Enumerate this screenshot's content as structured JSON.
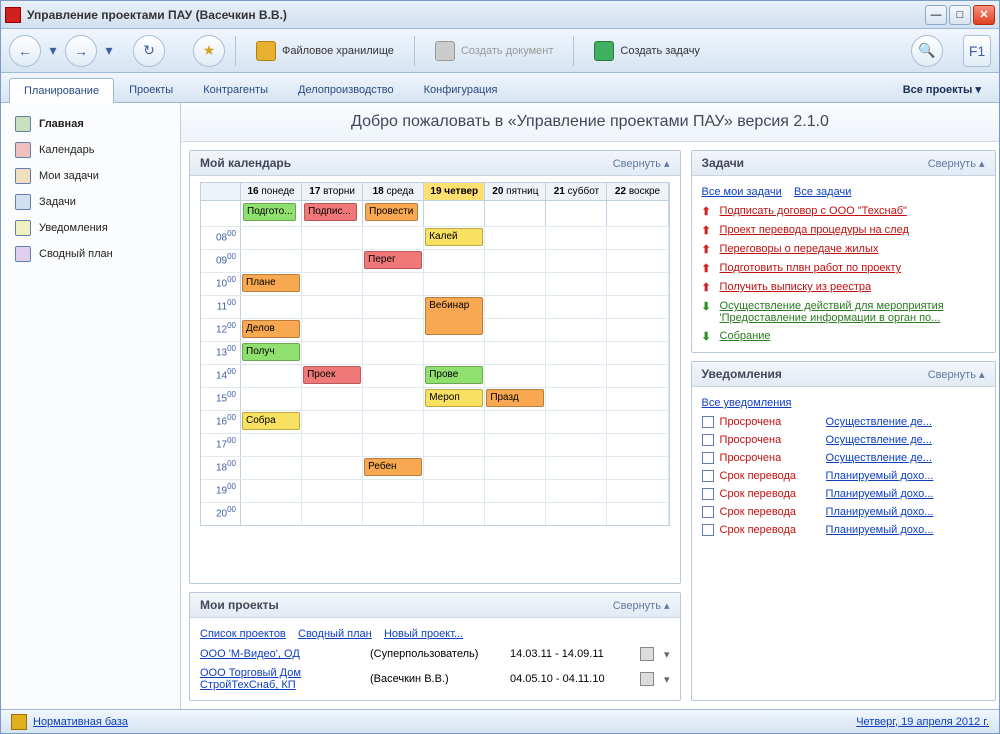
{
  "window": {
    "title": "Управление проектами ПАУ (Васечкин В.В.)"
  },
  "toolbar": {
    "file_storage": "Файловое хранилище",
    "create_doc": "Создать документ",
    "create_task": "Создать задачу"
  },
  "tabs": {
    "items": [
      "Планирование",
      "Проекты",
      "Контрагенты",
      "Делопроизводство",
      "Конфигурация"
    ],
    "right": "Все проекты ▾"
  },
  "sidebar": {
    "items": [
      {
        "label": "Главная"
      },
      {
        "label": "Календарь"
      },
      {
        "label": "Мои задачи"
      },
      {
        "label": "Задачи"
      },
      {
        "label": "Уведомления"
      },
      {
        "label": "Сводный план"
      }
    ]
  },
  "welcome": "Добро пожаловать в «Управление проектами ПАУ» версия 2.1.0",
  "collapse_label": "Свернуть ▴",
  "calendar": {
    "title": "Мой календарь",
    "days": [
      {
        "d": "16",
        "w": "понеде"
      },
      {
        "d": "17",
        "w": "вторни"
      },
      {
        "d": "18",
        "w": "среда"
      },
      {
        "d": "19",
        "w": "четвер"
      },
      {
        "d": "20",
        "w": "пятниц"
      },
      {
        "d": "21",
        "w": "суббот"
      },
      {
        "d": "22",
        "w": "воскре"
      }
    ],
    "hours": [
      "08",
      "09",
      "10",
      "11",
      "12",
      "13",
      "14",
      "15",
      "16",
      "17",
      "18",
      "19",
      "20"
    ],
    "allday": [
      {
        "day": 0,
        "label": "Подгото...",
        "color": "green"
      },
      {
        "day": 1,
        "label": "Подпис...",
        "color": "red"
      },
      {
        "day": 2,
        "label": "Провести",
        "color": "orange"
      }
    ],
    "events": [
      {
        "day": 3,
        "hour": "08",
        "label": "Калей",
        "color": "yellow"
      },
      {
        "day": 2,
        "hour": "09",
        "label": "Перег",
        "color": "red"
      },
      {
        "day": 0,
        "hour": "10",
        "label": "Плане",
        "color": "orange"
      },
      {
        "day": 3,
        "hour": "11",
        "label": "Вебинар",
        "color": "orange",
        "tall": true
      },
      {
        "day": 0,
        "hour": "12",
        "label": "Делов",
        "color": "orange"
      },
      {
        "day": 0,
        "hour": "13",
        "label": "Получ",
        "color": "green"
      },
      {
        "day": 1,
        "hour": "14",
        "label": "Проек",
        "color": "red"
      },
      {
        "day": 3,
        "hour": "14",
        "label": "Прове",
        "color": "green"
      },
      {
        "day": 3,
        "hour": "15",
        "label": "Мероп",
        "color": "yellow"
      },
      {
        "day": 4,
        "hour": "15",
        "label": "Празд",
        "color": "orange"
      },
      {
        "day": 0,
        "hour": "16",
        "label": "Собра",
        "color": "yellow"
      },
      {
        "day": 2,
        "hour": "18",
        "label": "Ребен",
        "color": "orange"
      }
    ]
  },
  "tasks": {
    "title": "Задачи",
    "links": {
      "mine": "Все мои задачи",
      "all": "Все задачи"
    },
    "items": [
      {
        "dir": "up",
        "label": "Подписать договор с ООО \"Техснаб\""
      },
      {
        "dir": "up",
        "label": "Проект перевода процедуры на след"
      },
      {
        "dir": "up",
        "label": "Переговоры о передаче жилых"
      },
      {
        "dir": "up",
        "label": "Подготовить плвн работ по проекту"
      },
      {
        "dir": "up",
        "label": "Получить выписку из реестра"
      },
      {
        "dir": "down",
        "label": "Осуществление действий для мероприятия 'Предоставление информации в орган по..."
      },
      {
        "dir": "down",
        "label": "Собрание"
      }
    ]
  },
  "notifications": {
    "title": "Уведомления",
    "link": "Все уведомления",
    "items": [
      {
        "status": "Просрочена",
        "link": "Осуществление де..."
      },
      {
        "status": "Просрочена",
        "link": "Осуществление де..."
      },
      {
        "status": "Просрочена",
        "link": "Осуществление де..."
      },
      {
        "status": "Срок перевода",
        "link": "Планируемый дохо..."
      },
      {
        "status": "Срок перевода",
        "link": "Планируемый дохо..."
      },
      {
        "status": "Срок перевода",
        "link": "Планируемый дохо..."
      },
      {
        "status": "Срок перевода",
        "link": "Планируемый дохо..."
      }
    ]
  },
  "projects": {
    "title": "Мои проекты",
    "links": {
      "list": "Список проектов",
      "plan": "Сводный план",
      "new": "Новый проект..."
    },
    "items": [
      {
        "name": "ООО 'М-Видео', ОД",
        "user": "(Суперпользователь)",
        "dates": "14.03.11 - 14.09.11"
      },
      {
        "name": "ООО Торговый Дом СтройТехСнаб, КП",
        "user": "(Васечкин В.В.)",
        "dates": "04.05.10 - 04.11.10"
      }
    ]
  },
  "statusbar": {
    "link": "Нормативная база",
    "date": "Четверг, 19 апреля 2012 г."
  }
}
